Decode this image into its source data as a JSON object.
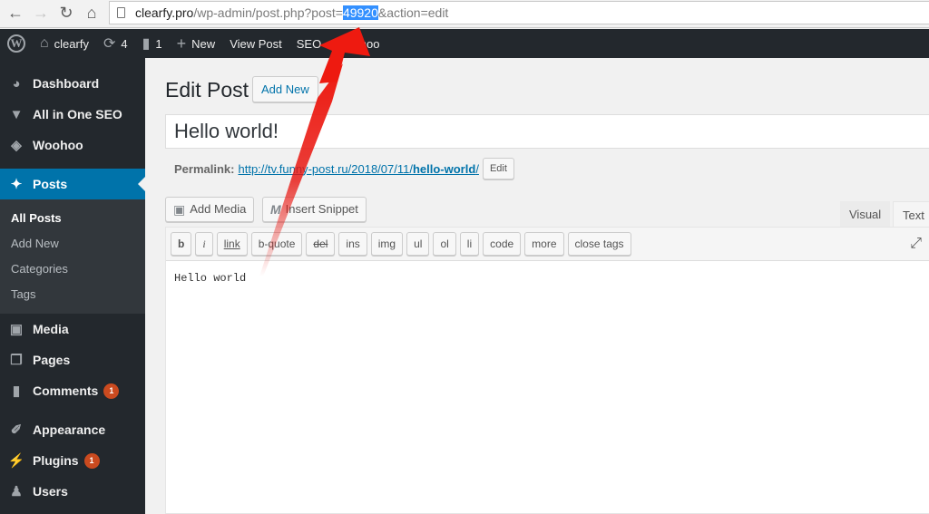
{
  "browser": {
    "url_host": "clearfy.pro",
    "url_path": "/wp-admin/post.php?post=",
    "url_selected": "49920",
    "url_rest": "&action=edit"
  },
  "adminbar": {
    "site_name": "clearfy",
    "updates_count": "4",
    "comments_count": "1",
    "new_label": "New",
    "view_post": "View Post",
    "seo": "SEO",
    "woohoo": "Woohoo"
  },
  "sidebar": {
    "items": [
      {
        "label": "Dashboard"
      },
      {
        "label": "All in One SEO"
      },
      {
        "label": "Woohoo"
      },
      {
        "label": "Posts"
      },
      {
        "label": "Media"
      },
      {
        "label": "Pages"
      },
      {
        "label": "Comments",
        "badge": "1"
      },
      {
        "label": "Appearance"
      },
      {
        "label": "Plugins",
        "badge": "1"
      },
      {
        "label": "Users"
      }
    ],
    "posts_submenu": [
      "All Posts",
      "Add New",
      "Categories",
      "Tags"
    ]
  },
  "main": {
    "page_title": "Edit Post",
    "add_new": "Add New",
    "post_title": "Hello world!",
    "permalink_label": "Permalink:",
    "permalink_prefix": "http://tv.funny-post.ru/2018/07/11/",
    "permalink_slug": "hello-world",
    "permalink_suffix": "/",
    "permalink_edit": "Edit",
    "add_media": "Add Media",
    "insert_snippet": "Insert Snippet",
    "tab_visual": "Visual",
    "tab_text": "Text",
    "quicktags": [
      "b",
      "i",
      "link",
      "b-quote",
      "del",
      "ins",
      "img",
      "ul",
      "ol",
      "li",
      "code",
      "more",
      "close tags"
    ],
    "content": "Hello world"
  },
  "annotation": {
    "arrow_color": "#e8120c"
  }
}
